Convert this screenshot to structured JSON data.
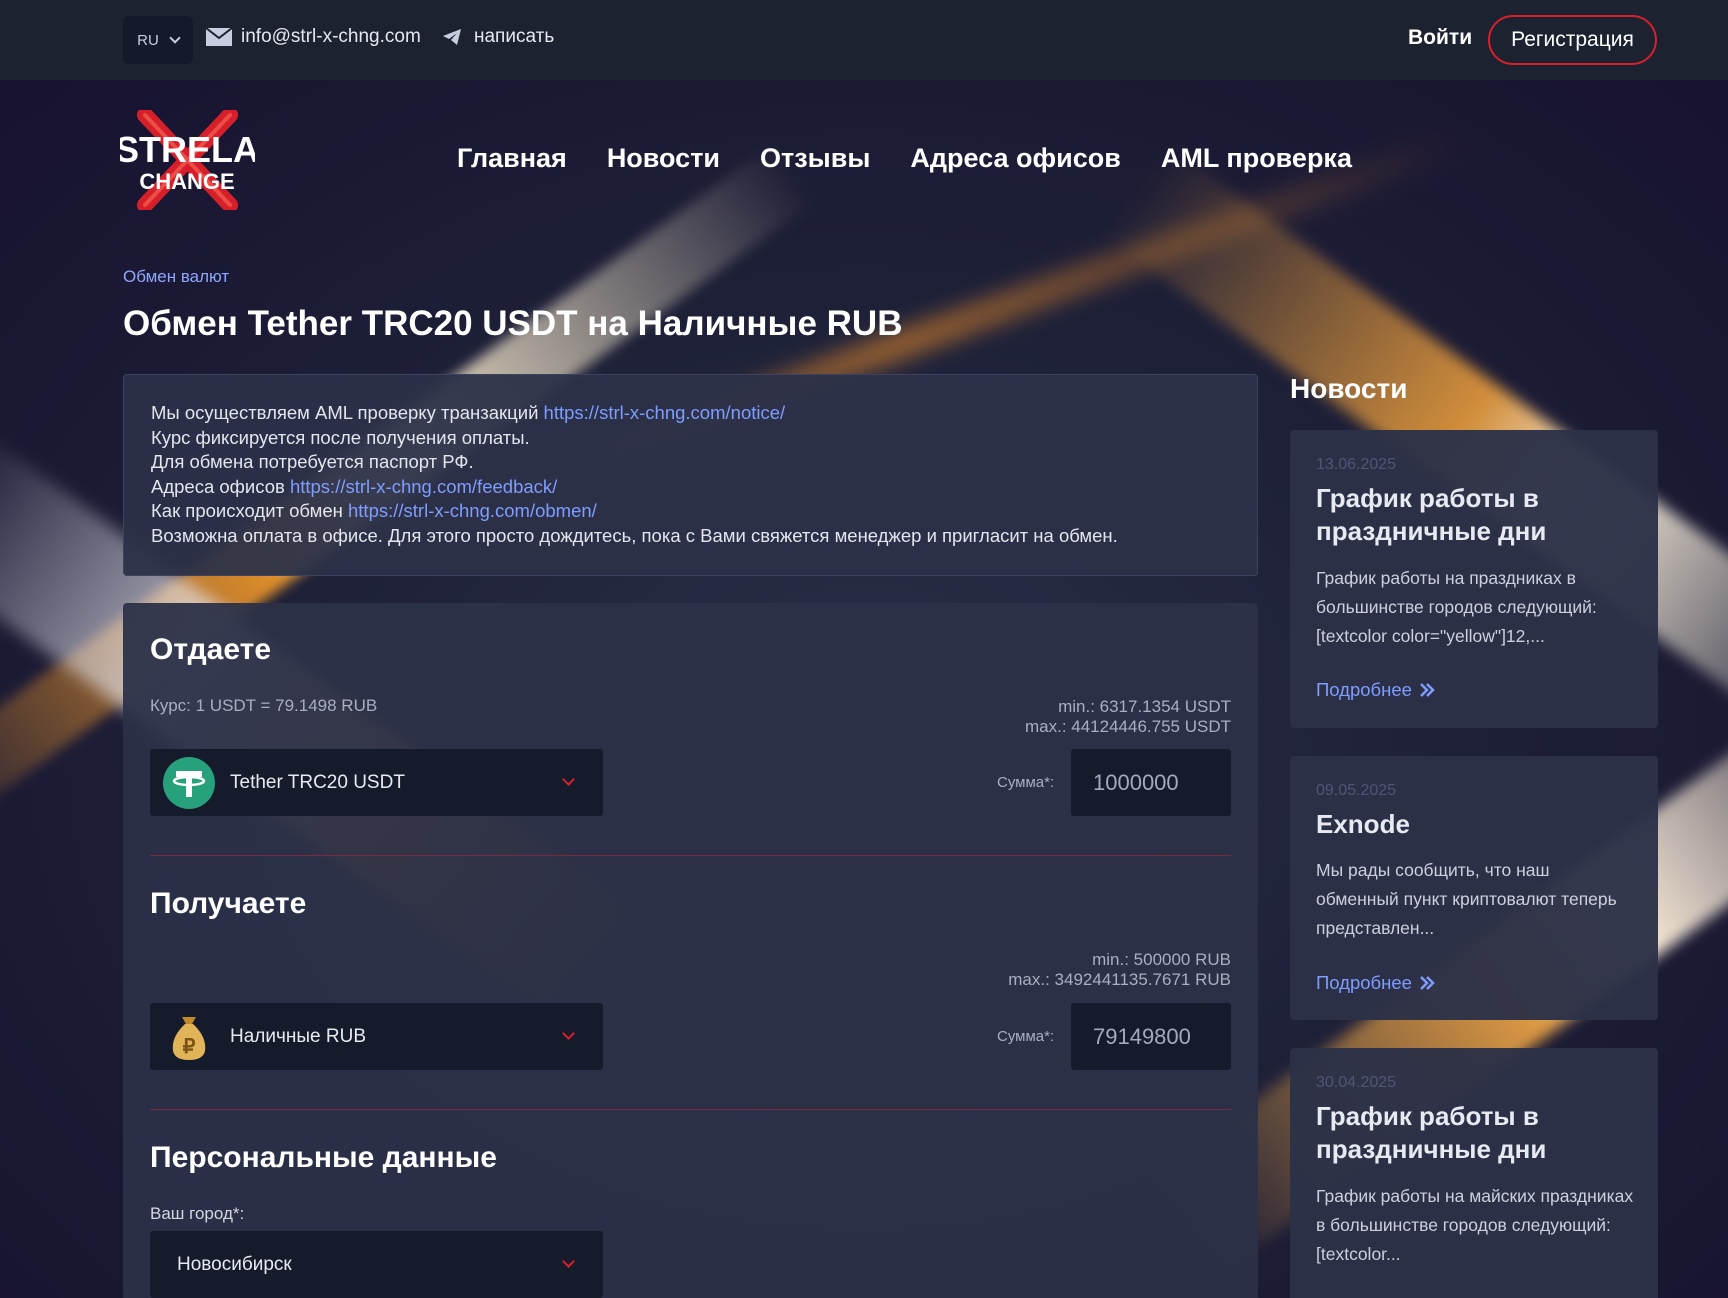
{
  "topbar": {
    "lang": "RU",
    "email": "info@strl-x-chng.com",
    "write": "написать",
    "login": "Войти",
    "register": "Регистрация"
  },
  "logo": {
    "line1": "STRELA",
    "line2": "CHANGE"
  },
  "nav": [
    "Главная",
    "Новости",
    "Отзывы",
    "Адреса офисов",
    "AML проверка"
  ],
  "breadcrumb": "Обмен валют",
  "page_title": "Обмен Tether TRC20 USDT на Наличные RUB",
  "notice": {
    "line1_text": "Мы осуществляем AML проверку транзакций ",
    "line1_link": "https://strl-x-chng.com/notice/",
    "line2": "Курс фиксируется после получения оплаты.",
    "line3": "Для обмена потребуется паспорт РФ.",
    "line4_text": "Адреса офисов ",
    "line4_link": "https://strl-x-chng.com/feedback/",
    "line5_text": "Как происходит обмен ",
    "line5_link": "https://strl-x-chng.com/obmen/",
    "line6": "Возможна оплата в офисе. Для этого просто дождитесь, пока с Вами свяжется менеджер и пригласит на обмен."
  },
  "give": {
    "heading": "Отдаете",
    "rate": "Курс: 1 USDT = 79.1498 RUB",
    "min": "min.: 6317.1354 USDT",
    "max": "max.: 44124446.755 USDT",
    "currency": "Tether TRC20 USDT",
    "sum_label": "Сумма*:",
    "sum_value": "1000000"
  },
  "get": {
    "heading": "Получаете",
    "min": "min.: 500000 RUB",
    "max": "max.: 3492441135.7671 RUB",
    "currency": "Наличные RUB",
    "sum_label": "Сумма*:",
    "sum_value": "79149800"
  },
  "personal": {
    "heading": "Персональные данные",
    "city_label": "Ваш город*:",
    "city_value": "Новосибирск"
  },
  "sidebar": {
    "title": "Новости",
    "more_label": "Подробнее",
    "news": [
      {
        "date": "13.06.2025",
        "title": "График работы в праздничные дни",
        "text": "График работы на праздниках в большинстве городов следующий: [textcolor color=\"yellow\"]12,..."
      },
      {
        "date": "09.05.2025",
        "title": "Exnode",
        "text": "Мы рады сообщить, что наш обменный пункт криптовалют теперь представлен..."
      },
      {
        "date": "30.04.2025",
        "title": "График работы в праздничные дни",
        "text": "График работы на майских праздниках в большинстве городов следующий: [textcolor..."
      }
    ]
  },
  "colors": {
    "accent_red": "#d8202a",
    "link_blue": "#7f9cff",
    "tether_green": "#26a17b",
    "panel": "#2c3148"
  }
}
